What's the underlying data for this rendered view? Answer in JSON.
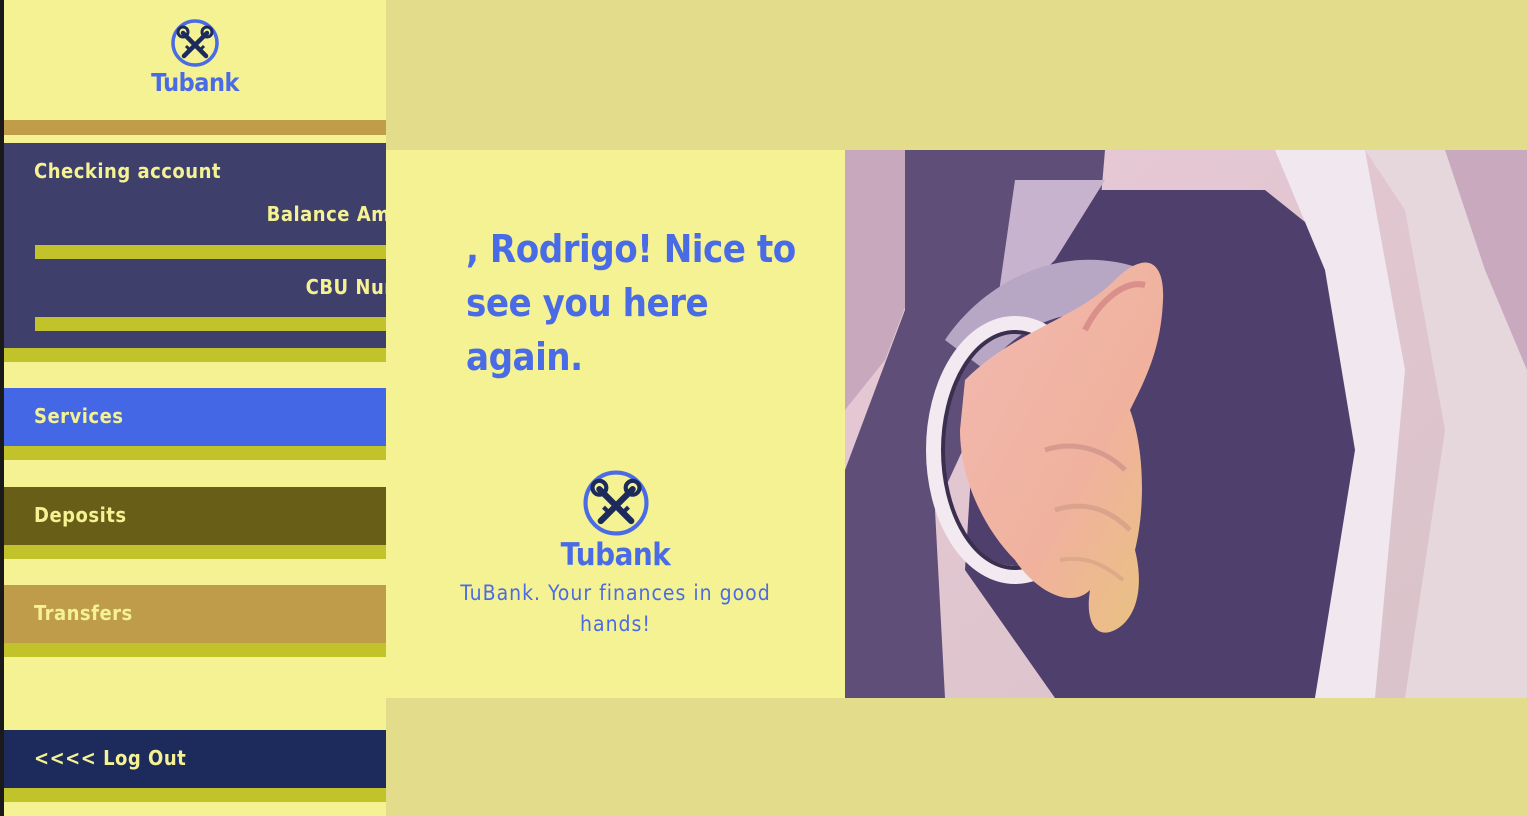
{
  "brand": {
    "name": "Tubank"
  },
  "sidebar": {
    "items": [
      {
        "label": "Checking account"
      },
      {
        "label": "Services"
      },
      {
        "label": "Deposits"
      },
      {
        "label": "Transfers"
      }
    ],
    "logout_label": "<<<< Log Out"
  },
  "submenu": {
    "items": [
      {
        "label": "Balance Amount"
      },
      {
        "label": "CBU Number"
      }
    ]
  },
  "main": {
    "greeting": ", Rodrigo! Nice to see you here again.",
    "tagline": "TuBank. Your finances in good hands!"
  },
  "colors": {
    "page_bg": "#e3dd8b",
    "panel_bg": "#f4f292",
    "accent_blue": "#4a6be6",
    "menu_dark": "#3f3f6b",
    "services_bg": "#4467e6",
    "deposits_bg": "#695e17",
    "transfers_bg": "#be9c4a",
    "logout_bg": "#1c2a5c",
    "underline": "#c2c22a"
  },
  "icons": {
    "logo": "crossed-keys-icon",
    "photo": "handshake-hand-image"
  }
}
